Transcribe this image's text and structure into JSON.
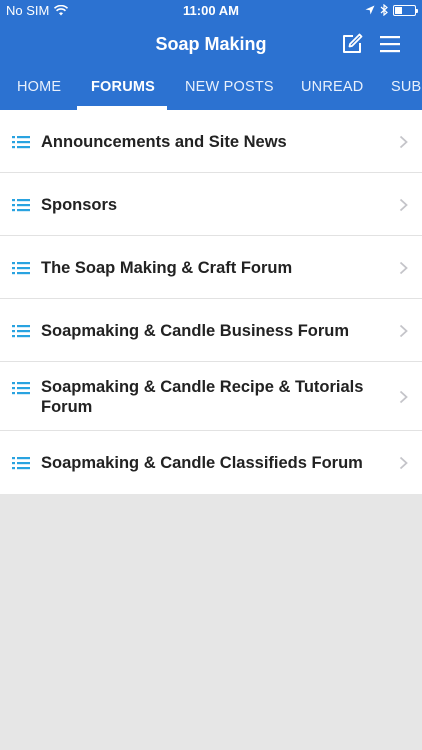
{
  "status": {
    "carrier": "No SIM",
    "time": "11:00 AM"
  },
  "header": {
    "title": "Soap Making"
  },
  "tabs": [
    {
      "label": "HOME"
    },
    {
      "label": "FORUMS"
    },
    {
      "label": "NEW POSTS"
    },
    {
      "label": "UNREAD"
    },
    {
      "label": "SUBSCRIBED"
    }
  ],
  "forums": [
    {
      "label": "Announcements and Site News"
    },
    {
      "label": "Sponsors"
    },
    {
      "label": "The Soap Making & Craft Forum"
    },
    {
      "label": "Soapmaking & Candle Business Forum"
    },
    {
      "label": "Soapmaking & Candle Recipe & Tutorials Forum"
    },
    {
      "label": "Soapmaking & Candle Classifieds Forum"
    }
  ],
  "colors": {
    "accent": "#2c72d1",
    "list_icon": "#29a3e0",
    "background": "#e6e6e6"
  },
  "icons": [
    "wifi-icon",
    "location-arrow-icon",
    "bluetooth-icon",
    "battery-icon",
    "compose-icon",
    "hamburger-menu-icon",
    "list-icon",
    "chevron-right-icon"
  ]
}
